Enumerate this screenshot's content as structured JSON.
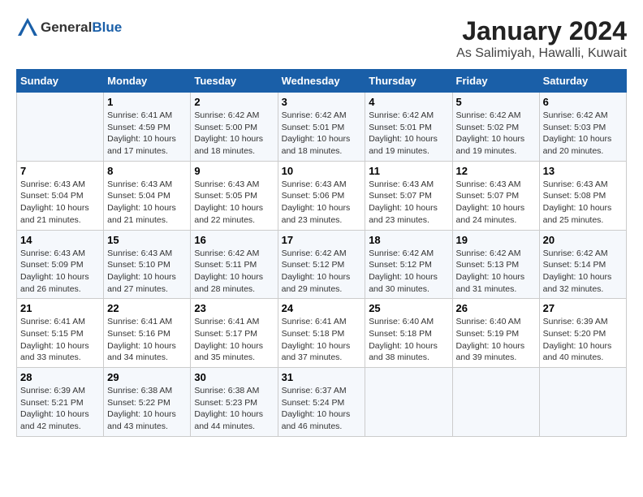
{
  "logo": {
    "general": "General",
    "blue": "Blue"
  },
  "title": "January 2024",
  "subtitle": "As Salimiyah, Hawalli, Kuwait",
  "days_of_week": [
    "Sunday",
    "Monday",
    "Tuesday",
    "Wednesday",
    "Thursday",
    "Friday",
    "Saturday"
  ],
  "weeks": [
    [
      {
        "day": "",
        "info": ""
      },
      {
        "day": "1",
        "info": "Sunrise: 6:41 AM\nSunset: 4:59 PM\nDaylight: 10 hours\nand 17 minutes."
      },
      {
        "day": "2",
        "info": "Sunrise: 6:42 AM\nSunset: 5:00 PM\nDaylight: 10 hours\nand 18 minutes."
      },
      {
        "day": "3",
        "info": "Sunrise: 6:42 AM\nSunset: 5:01 PM\nDaylight: 10 hours\nand 18 minutes."
      },
      {
        "day": "4",
        "info": "Sunrise: 6:42 AM\nSunset: 5:01 PM\nDaylight: 10 hours\nand 19 minutes."
      },
      {
        "day": "5",
        "info": "Sunrise: 6:42 AM\nSunset: 5:02 PM\nDaylight: 10 hours\nand 19 minutes."
      },
      {
        "day": "6",
        "info": "Sunrise: 6:42 AM\nSunset: 5:03 PM\nDaylight: 10 hours\nand 20 minutes."
      }
    ],
    [
      {
        "day": "7",
        "info": "Sunrise: 6:43 AM\nSunset: 5:04 PM\nDaylight: 10 hours\nand 21 minutes."
      },
      {
        "day": "8",
        "info": "Sunrise: 6:43 AM\nSunset: 5:04 PM\nDaylight: 10 hours\nand 21 minutes."
      },
      {
        "day": "9",
        "info": "Sunrise: 6:43 AM\nSunset: 5:05 PM\nDaylight: 10 hours\nand 22 minutes."
      },
      {
        "day": "10",
        "info": "Sunrise: 6:43 AM\nSunset: 5:06 PM\nDaylight: 10 hours\nand 23 minutes."
      },
      {
        "day": "11",
        "info": "Sunrise: 6:43 AM\nSunset: 5:07 PM\nDaylight: 10 hours\nand 23 minutes."
      },
      {
        "day": "12",
        "info": "Sunrise: 6:43 AM\nSunset: 5:07 PM\nDaylight: 10 hours\nand 24 minutes."
      },
      {
        "day": "13",
        "info": "Sunrise: 6:43 AM\nSunset: 5:08 PM\nDaylight: 10 hours\nand 25 minutes."
      }
    ],
    [
      {
        "day": "14",
        "info": "Sunrise: 6:43 AM\nSunset: 5:09 PM\nDaylight: 10 hours\nand 26 minutes."
      },
      {
        "day": "15",
        "info": "Sunrise: 6:43 AM\nSunset: 5:10 PM\nDaylight: 10 hours\nand 27 minutes."
      },
      {
        "day": "16",
        "info": "Sunrise: 6:42 AM\nSunset: 5:11 PM\nDaylight: 10 hours\nand 28 minutes."
      },
      {
        "day": "17",
        "info": "Sunrise: 6:42 AM\nSunset: 5:12 PM\nDaylight: 10 hours\nand 29 minutes."
      },
      {
        "day": "18",
        "info": "Sunrise: 6:42 AM\nSunset: 5:12 PM\nDaylight: 10 hours\nand 30 minutes."
      },
      {
        "day": "19",
        "info": "Sunrise: 6:42 AM\nSunset: 5:13 PM\nDaylight: 10 hours\nand 31 minutes."
      },
      {
        "day": "20",
        "info": "Sunrise: 6:42 AM\nSunset: 5:14 PM\nDaylight: 10 hours\nand 32 minutes."
      }
    ],
    [
      {
        "day": "21",
        "info": "Sunrise: 6:41 AM\nSunset: 5:15 PM\nDaylight: 10 hours\nand 33 minutes."
      },
      {
        "day": "22",
        "info": "Sunrise: 6:41 AM\nSunset: 5:16 PM\nDaylight: 10 hours\nand 34 minutes."
      },
      {
        "day": "23",
        "info": "Sunrise: 6:41 AM\nSunset: 5:17 PM\nDaylight: 10 hours\nand 35 minutes."
      },
      {
        "day": "24",
        "info": "Sunrise: 6:41 AM\nSunset: 5:18 PM\nDaylight: 10 hours\nand 37 minutes."
      },
      {
        "day": "25",
        "info": "Sunrise: 6:40 AM\nSunset: 5:18 PM\nDaylight: 10 hours\nand 38 minutes."
      },
      {
        "day": "26",
        "info": "Sunrise: 6:40 AM\nSunset: 5:19 PM\nDaylight: 10 hours\nand 39 minutes."
      },
      {
        "day": "27",
        "info": "Sunrise: 6:39 AM\nSunset: 5:20 PM\nDaylight: 10 hours\nand 40 minutes."
      }
    ],
    [
      {
        "day": "28",
        "info": "Sunrise: 6:39 AM\nSunset: 5:21 PM\nDaylight: 10 hours\nand 42 minutes."
      },
      {
        "day": "29",
        "info": "Sunrise: 6:38 AM\nSunset: 5:22 PM\nDaylight: 10 hours\nand 43 minutes."
      },
      {
        "day": "30",
        "info": "Sunrise: 6:38 AM\nSunset: 5:23 PM\nDaylight: 10 hours\nand 44 minutes."
      },
      {
        "day": "31",
        "info": "Sunrise: 6:37 AM\nSunset: 5:24 PM\nDaylight: 10 hours\nand 46 minutes."
      },
      {
        "day": "",
        "info": ""
      },
      {
        "day": "",
        "info": ""
      },
      {
        "day": "",
        "info": ""
      }
    ]
  ]
}
